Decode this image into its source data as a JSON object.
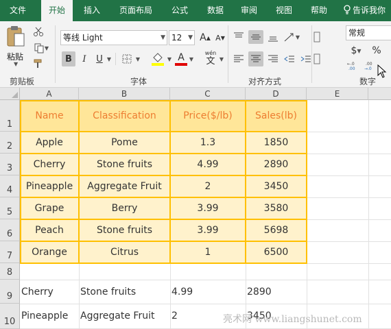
{
  "ribbon": {
    "tabs": [
      {
        "label": "文件",
        "active": false
      },
      {
        "label": "开始",
        "active": true
      },
      {
        "label": "插入",
        "active": false
      },
      {
        "label": "页面布局",
        "active": false
      },
      {
        "label": "公式",
        "active": false
      },
      {
        "label": "数据",
        "active": false
      },
      {
        "label": "审阅",
        "active": false
      },
      {
        "label": "视图",
        "active": false
      },
      {
        "label": "帮助",
        "active": false
      }
    ],
    "tell_me": "告诉我你",
    "clipboard": {
      "paste_label": "粘贴",
      "group_label": "剪贴板"
    },
    "font": {
      "name": "等线 Light",
      "size": "12",
      "group_label": "字体",
      "bold": "B",
      "italic": "I",
      "underline": "U",
      "grow": "A",
      "shrink": "A",
      "fill_letter": "A",
      "wen": "wén",
      "wen_char": "文"
    },
    "alignment": {
      "group_label": "对齐方式"
    },
    "number": {
      "format": "常规",
      "currency": "$",
      "percent": "%",
      "dec_inc": ".00→.0",
      "dec_dec": ".00",
      "group_label": "数字"
    },
    "colors": {
      "accent": "#217346",
      "font_color": "#e00000",
      "fill_color": "#ffff00",
      "table_border": "#ffc000",
      "table_header_fill": "#ffe699",
      "table_body_fill": "#fff2cc",
      "header_text": "#ed7d31"
    }
  },
  "sheet": {
    "columns": [
      "A",
      "B",
      "C",
      "D",
      "E"
    ],
    "rows": [
      "1",
      "2",
      "3",
      "4",
      "5",
      "6",
      "7",
      "8",
      "9",
      "10"
    ],
    "table": {
      "headers": [
        "Name",
        "Classification",
        "Price($/lb)",
        "Sales(lb)"
      ],
      "rows": [
        [
          "Apple",
          "Pome",
          "1.3",
          "1850"
        ],
        [
          "Cherry",
          "Stone fruits",
          "4.99",
          "2890"
        ],
        [
          "Pineapple",
          "Aggregate Fruit",
          "2",
          "3450"
        ],
        [
          "Grape",
          "Berry",
          "3.99",
          "3580"
        ],
        [
          "Peach",
          "Stone fruits",
          "3.99",
          "5698"
        ],
        [
          "Orange",
          "Citrus",
          "1",
          "6500"
        ]
      ]
    },
    "plain_rows": [
      [
        "Cherry",
        "Stone fruits",
        "4.99",
        "2890"
      ],
      [
        "Pineapple",
        "Aggregate Fruit",
        "2",
        "3450"
      ]
    ]
  },
  "watermark": "亮术网 www.liangshunet.com"
}
